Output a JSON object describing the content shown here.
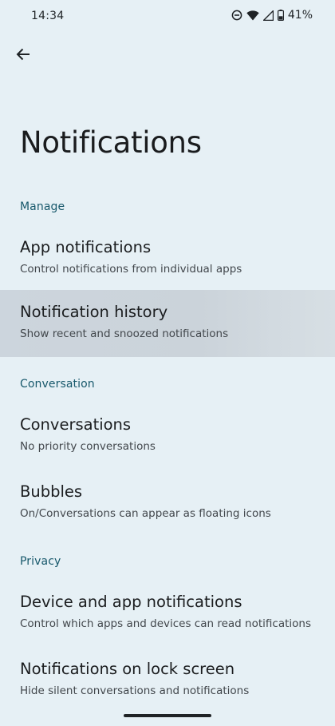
{
  "status_bar": {
    "time": "14:34",
    "battery_percent": "41%",
    "icons": [
      "do-not-disturb-icon",
      "wifi-icon",
      "signal-icon",
      "battery-icon"
    ]
  },
  "header": {
    "back_icon": "arrow-left-icon",
    "title": "Notifications"
  },
  "sections": {
    "manage": {
      "label": "Manage",
      "items": [
        {
          "title": "App notifications",
          "subtitle": "Control notifications from individual apps"
        },
        {
          "title": "Notification history",
          "subtitle": "Show recent and snoozed notifications"
        }
      ]
    },
    "conversation": {
      "label": "Conversation",
      "items": [
        {
          "title": "Conversations",
          "subtitle": "No priority conversations"
        },
        {
          "title": "Bubbles",
          "subtitle": "On/Conversations can appear as floating icons"
        }
      ]
    },
    "privacy": {
      "label": "Privacy",
      "items": [
        {
          "title": "Device and app notifications",
          "subtitle": "Control which apps and devices can read notifications"
        },
        {
          "title": "Notifications on lock screen",
          "subtitle": "Hide silent conversations and notifications"
        }
      ]
    }
  },
  "colors": {
    "background": "#e6f0f5",
    "section_header": "#17586b",
    "highlight": "#ccd5dd"
  }
}
